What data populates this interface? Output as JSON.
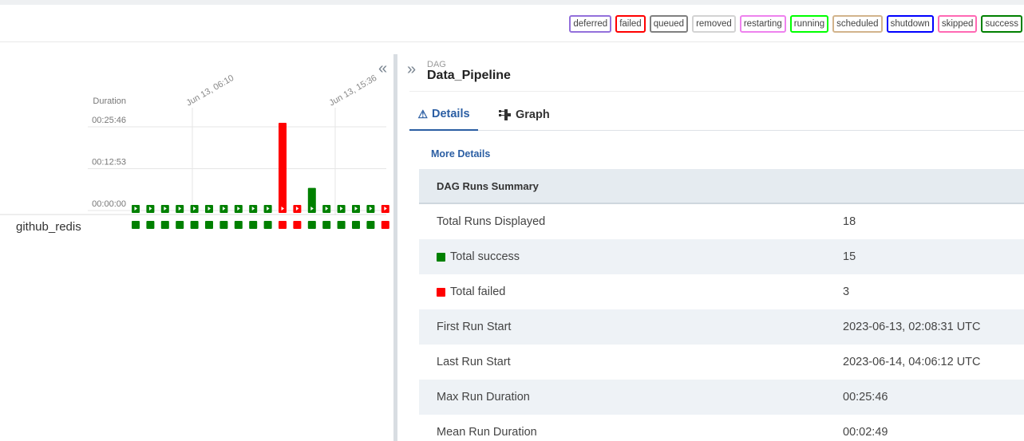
{
  "legend": {
    "states": [
      {
        "label": "deferred",
        "color": "#9370db"
      },
      {
        "label": "failed",
        "color": "#ff0000"
      },
      {
        "label": "queued",
        "color": "#808080"
      },
      {
        "label": "removed",
        "color": "#d3d3d3"
      },
      {
        "label": "restarting",
        "color": "#ee82ee"
      },
      {
        "label": "running",
        "color": "#00ff00"
      },
      {
        "label": "scheduled",
        "color": "#d2b48c"
      },
      {
        "label": "shutdown",
        "color": "#0000ff"
      },
      {
        "label": "skipped",
        "color": "#ff69b4"
      },
      {
        "label": "success",
        "color": "#008000"
      }
    ]
  },
  "grid": {
    "duration_label": "Duration",
    "y_ticks": [
      "00:25:46",
      "00:12:53",
      "00:00:00"
    ],
    "date_labels": [
      "Jun 13, 06:10",
      "Jun 13, 15:36"
    ],
    "task_name": "github_redis",
    "success_color": "#008000",
    "failed_color": "#ff0000"
  },
  "chart_data": {
    "type": "bar",
    "ylabel": "Duration",
    "ylim": [
      "00:00:00",
      "00:25:46"
    ],
    "y_ticks": [
      "00:00:00",
      "00:12:53",
      "00:25:46"
    ],
    "runs": [
      {
        "state": "success",
        "duration_s": 30
      },
      {
        "state": "success",
        "duration_s": 30
      },
      {
        "state": "success",
        "duration_s": 30
      },
      {
        "state": "success",
        "duration_s": 30
      },
      {
        "state": "success",
        "duration_s": 30
      },
      {
        "state": "success",
        "duration_s": 30
      },
      {
        "state": "success",
        "duration_s": 30
      },
      {
        "state": "success",
        "duration_s": 30
      },
      {
        "state": "success",
        "duration_s": 30
      },
      {
        "state": "success",
        "duration_s": 30
      },
      {
        "state": "failed",
        "duration_s": 1546
      },
      {
        "state": "failed",
        "duration_s": 40
      },
      {
        "state": "success",
        "duration_s": 430
      },
      {
        "state": "success",
        "duration_s": 30
      },
      {
        "state": "success",
        "duration_s": 30
      },
      {
        "state": "success",
        "duration_s": 30
      },
      {
        "state": "success",
        "duration_s": 30
      },
      {
        "state": "failed",
        "duration_s": 60
      }
    ]
  },
  "dag": {
    "kicker": "DAG",
    "title": "Data_Pipeline"
  },
  "tabs": {
    "details": "Details",
    "graph": "Graph"
  },
  "more_details": "More Details",
  "summary": {
    "header": "DAG Runs Summary",
    "rows": [
      {
        "label": "Total Runs Displayed",
        "value": "18"
      },
      {
        "label": "Total success",
        "value": "15"
      },
      {
        "label": "Total failed",
        "value": "3"
      },
      {
        "label": "First Run Start",
        "value": "2023-06-13, 02:08:31 UTC"
      },
      {
        "label": "Last Run Start",
        "value": "2023-06-14, 04:06:12 UTC"
      },
      {
        "label": "Max Run Duration",
        "value": "00:25:46"
      },
      {
        "label": "Mean Run Duration",
        "value": "00:02:49"
      }
    ]
  }
}
